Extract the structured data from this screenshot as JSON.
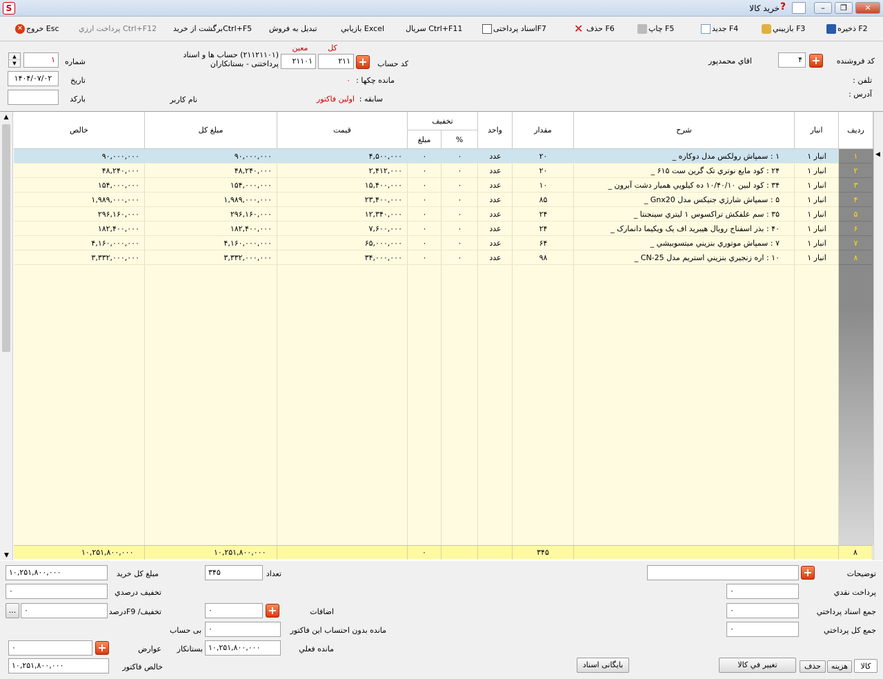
{
  "window": {
    "title": "خرید کالا",
    "minimize": "–",
    "restore": "❐",
    "close": "✕"
  },
  "toolbar": {
    "save": "ذخیره F2",
    "reload": "بازبيني F3",
    "new": "جدید F4",
    "print": "چاپ F5",
    "delete": "حذف F6",
    "payment_docs": "اسناد پرداختیF7",
    "serial": "سریال Ctrl+F11",
    "retrieve": "بازيابي Excel",
    "convert_sale": "تبدیل به فروش",
    "return_purchase": "برگشت از خریدCtrl+F5",
    "fx_payment": "پرداخت ارزي Ctrl+F12",
    "exit": "خروج Esc"
  },
  "header": {
    "vendor_code_label": "کد فروشنده",
    "vendor_code": "۴",
    "vendor_name": "اقاي محمدپور",
    "phone_label": "تلفن :",
    "address_label": "آدرس :",
    "account_label": "کد حساب",
    "kol_label": "کل",
    "kol_value": "۲۱۱",
    "moein_label": "معین",
    "moein_value": "۲۱۱۰۱",
    "account_desc_1": "(۲۱۱۲۱۱۰۱) حساب ها و اسناد",
    "account_desc_2": "پرداختنی - بستانکاران",
    "checks_label": "مانده چکها :",
    "checks_value": "۰",
    "history_label": "سابقه :",
    "history_value": "اولین فاکتور",
    "username_label": "نام کاربر",
    "number_label": "شماره",
    "number_value": "۱",
    "date_label": "تاریخ",
    "date_value": "۱۴۰۴/۰۷/۰۲",
    "barcode_label": "بارکد",
    "barcode_value": ""
  },
  "table": {
    "headers": {
      "row": "ردیف",
      "warehouse": "انبار",
      "desc": "شرح",
      "qty": "مقدار",
      "unit": "واحد",
      "discount": "تخفیف",
      "pct": "%",
      "disc_amount": "مبلغ",
      "price": "قیمت",
      "total": "مبلغ کل",
      "net": "خالص"
    },
    "rows": [
      {
        "n": "۱",
        "wh": "انبار ۱",
        "desc": "۱ : سمپاش رولکس مدل دوکاره _",
        "qty": "۲۰",
        "unit": "عدد",
        "pct": "۰",
        "damt": "۰",
        "price": "۴,۵۰۰,۰۰۰",
        "total": "۹۰,۰۰۰,۰۰۰",
        "net": "۹۰,۰۰۰,۰۰۰"
      },
      {
        "n": "۲",
        "wh": "انبار ۱",
        "desc": "۲۴ : کود مایع نوتري تک گرين ست ۶۱۵ _",
        "qty": "۲۰",
        "unit": "عدد",
        "pct": "۰",
        "damt": "۰",
        "price": "۲,۴۱۲,۰۰۰",
        "total": "۴۸,۲۴۰,۰۰۰",
        "net": "۴۸,۲۴۰,۰۰۰"
      },
      {
        "n": "۳",
        "wh": "انبار ۱",
        "desc": "۳۴ : کود لبین ۱۰/۴۰/۱۰ ده کیلویي همیار دشت آبرون _",
        "qty": "۱۰",
        "unit": "عدد",
        "pct": "۰",
        "damt": "۰",
        "price": "۱۵,۴۰۰,۰۰۰",
        "total": "۱۵۴,۰۰۰,۰۰۰",
        "net": "۱۵۴,۰۰۰,۰۰۰"
      },
      {
        "n": "۴",
        "wh": "انبار ۱",
        "desc": "۵ : سمپاش شارژي جنیکس مدل Gnx20 _",
        "qty": "۸۵",
        "unit": "عدد",
        "pct": "۰",
        "damt": "۰",
        "price": "۲۳,۴۰۰,۰۰۰",
        "total": "۱,۹۸۹,۰۰۰,۰۰۰",
        "net": "۱,۹۸۹,۰۰۰,۰۰۰"
      },
      {
        "n": "۵",
        "wh": "انبار ۱",
        "desc": "۳۵ : سم علفکش تراکسوس ۱ لیتري سینجنتا _",
        "qty": "۲۴",
        "unit": "عدد",
        "pct": "۰",
        "damt": "۰",
        "price": "۱۲,۳۴۰,۰۰۰",
        "total": "۲۹۶,۱۶۰,۰۰۰",
        "net": "۲۹۶,۱۶۰,۰۰۰"
      },
      {
        "n": "۶",
        "wh": "انبار ۱",
        "desc": "۴۰ : بذر اسفناج رويال هیبرید اف یک ویکیما دانمارک _",
        "qty": "۲۴",
        "unit": "عدد",
        "pct": "۰",
        "damt": "۰",
        "price": "۷,۶۰۰,۰۰۰",
        "total": "۱۸۲,۴۰۰,۰۰۰",
        "net": "۱۸۲,۴۰۰,۰۰۰"
      },
      {
        "n": "۷",
        "wh": "انبار ۱",
        "desc": "۷ : سمپاش موتوري بنزيني میتسوبیشي _",
        "qty": "۶۴",
        "unit": "عدد",
        "pct": "۰",
        "damt": "۰",
        "price": "۶۵,۰۰۰,۰۰۰",
        "total": "۴,۱۶۰,۰۰۰,۰۰۰",
        "net": "۴,۱۶۰,۰۰۰,۰۰۰"
      },
      {
        "n": "۸",
        "wh": "انبار ۱",
        "desc": "۱۰ : اره زنجیري بنزيني استریم مدل CN-25 _",
        "qty": "۹۸",
        "unit": "عدد",
        "pct": "۰",
        "damt": "۰",
        "price": "۳۴,۰۰۰,۰۰۰",
        "total": "۳,۳۳۲,۰۰۰,۰۰۰",
        "net": "۳,۳۳۲,۰۰۰,۰۰۰"
      }
    ],
    "footer": {
      "count": "۸",
      "qty": "۳۴۵",
      "damt": "۰",
      "total": "۱۰,۲۵۱,۸۰۰,۰۰۰",
      "net": "۱۰,۲۵۱,۸۰۰,۰۰۰"
    }
  },
  "bottom": {
    "total_label": "مبلغ کل خرید",
    "total_value": "۱۰,۲۵۱,۸۰۰,۰۰۰",
    "count_label": "تعداد",
    "count_value": "۳۴۵",
    "pct_discount_label": "تخفیف درصدي",
    "pct_discount_value": "۰",
    "discount_label": "تخفیف/ F9درصد",
    "discount_value": "۰",
    "additions_label": "اضافات",
    "additions_value": "۰",
    "no_account_label": "بی حساب",
    "no_account_value": "۰",
    "remaining_excl_label": "مانده بدون احتساب این فاکتور",
    "tolls_label": "عوارض",
    "tolls_value": "۰",
    "creditor_label": "بستانکار",
    "creditor_value": "۱۰,۲۵۱,۸۰۰,۰۰۰",
    "current_balance_label": "مانده فعلي",
    "net_label": "خالص فاکتور",
    "net_value": "۱۰,۲۵۱,۸۰۰,۰۰۰",
    "notes_label": "توضیحات",
    "notes_value": "",
    "cash_label": "پرداخت نقدي",
    "cash_value": "۰",
    "docs_label": "جمع اسناد پرداختي",
    "docs_value": "۰",
    "total_pay_label": "جمع کل پرداختي",
    "total_pay_value": "۰",
    "archive_btn": "بایگانی اسناد",
    "change_btn": "تغییر في کالا",
    "tab_goods": "کالا",
    "tab_cost": "هزینه",
    "tab_delete": "حذف",
    "ellipsis": "..."
  },
  "colors": {
    "selected_row": "#cde3ee",
    "row_bg": "#fefbe0",
    "footer_bg": "#fff9a0",
    "rownum_bg": "#8a8a8a",
    "rownum_fg": "#ffe000",
    "accent_red": "#d83a10"
  }
}
